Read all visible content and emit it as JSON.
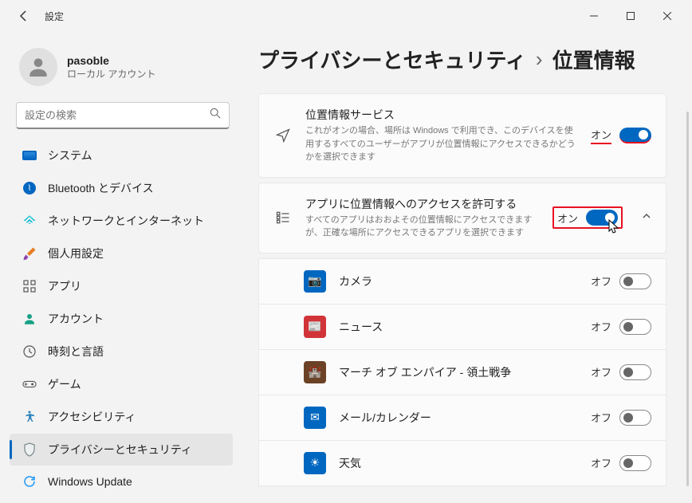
{
  "window": {
    "title": "設定"
  },
  "user": {
    "name": "pasoble",
    "account_type": "ローカル アカウント"
  },
  "search": {
    "placeholder": "設定の検索"
  },
  "nav": [
    {
      "id": "system",
      "label": "システム"
    },
    {
      "id": "bluetooth",
      "label": "Bluetooth とデバイス"
    },
    {
      "id": "network",
      "label": "ネットワークとインターネット"
    },
    {
      "id": "personalization",
      "label": "個人用設定"
    },
    {
      "id": "apps",
      "label": "アプリ"
    },
    {
      "id": "accounts",
      "label": "アカウント"
    },
    {
      "id": "time",
      "label": "時刻と言語"
    },
    {
      "id": "gaming",
      "label": "ゲーム"
    },
    {
      "id": "accessibility",
      "label": "アクセシビリティ"
    },
    {
      "id": "privacy",
      "label": "プライバシーとセキュリティ",
      "active": true
    },
    {
      "id": "update",
      "label": "Windows Update"
    }
  ],
  "breadcrumb": {
    "parent": "プライバシーとセキュリティ",
    "current": "位置情報"
  },
  "settings": {
    "location_service": {
      "title": "位置情報サービス",
      "desc": "これがオンの場合、場所は Windows で利用でき、このデバイスを使用するすべてのユーザーがアプリが位置情報にアクセスできるかどうかを選択できます",
      "state_label": "オン",
      "state": true
    },
    "app_access": {
      "title": "アプリに位置情報へのアクセスを許可する",
      "desc": "すべてのアプリはおおよその位置情報にアクセスできますが、正確な場所にアクセスできるアプリを選択できます",
      "state_label": "オン",
      "state": true
    }
  },
  "apps": [
    {
      "id": "camera",
      "name": "カメラ",
      "state_label": "オフ",
      "state": false,
      "color": "#0067c0",
      "glyph": "📷"
    },
    {
      "id": "news",
      "name": "ニュース",
      "state_label": "オフ",
      "state": false,
      "color": "#d13438",
      "glyph": "📰"
    },
    {
      "id": "empire",
      "name": "マーチ オブ エンパイア - 領土戦争",
      "state_label": "オフ",
      "state": false,
      "color": "#6b4226",
      "glyph": "🏰"
    },
    {
      "id": "mail",
      "name": "メール/カレンダー",
      "state_label": "オフ",
      "state": false,
      "color": "#0067c0",
      "glyph": "✉"
    },
    {
      "id": "weather",
      "name": "天気",
      "state_label": "オフ",
      "state": false,
      "color": "#0067c0",
      "glyph": "☀"
    }
  ]
}
